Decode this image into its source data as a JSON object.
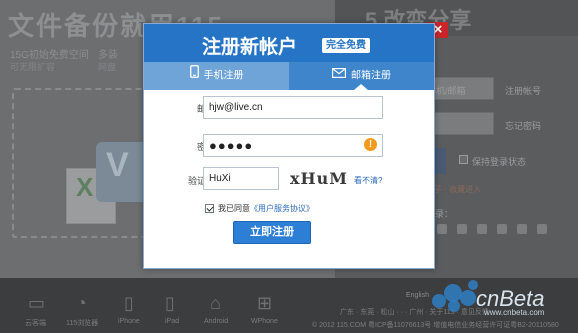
{
  "background": {
    "headline": "文件备份就用115",
    "feature1": "15G初始免费空间",
    "feature1_sub": "可无限扩容",
    "feature2": "多装",
    "feature2_sub": "网盘",
    "brand": "5 改变分享",
    "brand_style": "STYLE",
    "right_labels": {
      "phone_email": "手机/邮箱",
      "register_account": "注册帐号",
      "forgot_password": "忘记密码",
      "keep_login": "保持登录状态",
      "red_note": "孩子 · 收藏进入",
      "login": "登录："
    },
    "footer_items": [
      {
        "icon": "desktop-icon",
        "label": "云客端"
      },
      {
        "icon": "app-115-icon",
        "label": "115浏览器"
      },
      {
        "icon": "iphone-icon",
        "label": "iPhone"
      },
      {
        "icon": "ipad-icon",
        "label": "iPad"
      },
      {
        "icon": "android-icon",
        "label": "Android"
      },
      {
        "icon": "windows-phone-icon",
        "label": "WPhone"
      }
    ],
    "footer_nav": "广东 · 东莞 · 松山 ·   ·   · 广州 · 关于115 · 意见反馈",
    "copyright": "© 2012 115.COM 粤ICP备11076613号 增值电信业务经营许可证粤B2-20110580",
    "lang": "English",
    "watermark": "cnBeta",
    "watermark_url": "www.cnbeta.com"
  },
  "modal": {
    "title": "注册新帐户",
    "badge": "完全免费",
    "close_label": "×",
    "tabs": [
      {
        "label": "手机注册",
        "icon": "mobile-phone-icon",
        "active": false
      },
      {
        "label": "邮箱注册",
        "icon": "envelope-icon",
        "active": true
      }
    ],
    "form": {
      "email_label": "邮箱：",
      "email_value": "hjw@live.cn",
      "password_label": "密码：",
      "password_value": "●●●●●",
      "warning_icon": "!",
      "captcha_label": "验证码：",
      "captcha_value": "HuXi",
      "captcha_image_text": "xHuM",
      "captcha_refresh": "看不清?",
      "agree_prefix": "我已同意",
      "agree_link": "《用户服务协议》",
      "agree_checked": true,
      "submit_label": "立即注册"
    }
  },
  "colors": {
    "header_blue": "#2674c6",
    "tab_inactive": "#6ea4d8",
    "tab_active": "#3e85cc",
    "button_blue": "#2d7fd6",
    "close_red": "#c9262a",
    "warning_orange": "#f39a1b",
    "link_blue": "#2b6bbf"
  }
}
